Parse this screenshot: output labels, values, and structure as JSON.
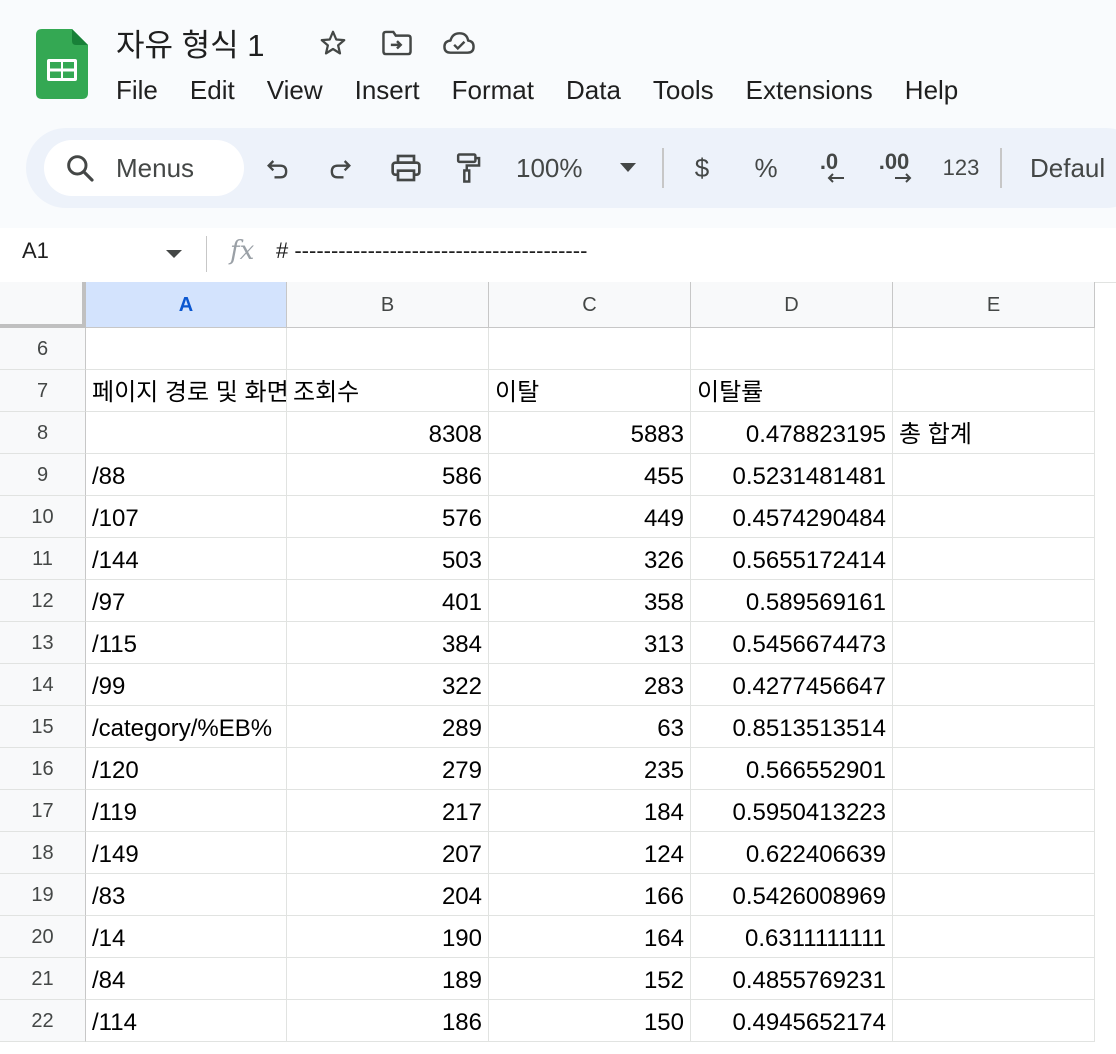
{
  "app": {
    "title": "자유 형식 1",
    "icons": {
      "logo": "google-sheets-logo",
      "star": "star-icon",
      "move": "move-to-folder-icon",
      "cloud": "cloud-saved-icon"
    }
  },
  "menu": [
    "File",
    "Edit",
    "View",
    "Insert",
    "Format",
    "Data",
    "Tools",
    "Extensions",
    "Help"
  ],
  "toolbar": {
    "search_label": "Menus",
    "zoom": "100%",
    "currency": "$",
    "percent": "%",
    "decrease_decimal": ".0",
    "increase_decimal": ".00",
    "number_format": "123",
    "font": "Defaul"
  },
  "formula_bar": {
    "name_box": "A1",
    "fx": "fx",
    "formula": "# ----------------------------------------"
  },
  "grid": {
    "selected_column": "A",
    "columns": [
      "A",
      "B",
      "C",
      "D",
      "E"
    ],
    "rows": [
      {
        "n": "6",
        "a": "",
        "b": "",
        "c": "",
        "d": "",
        "e": ""
      },
      {
        "n": "7",
        "a": "페이지 경로 및 화면",
        "b": "조회수",
        "c": "이탈",
        "d": "이탈률",
        "e": ""
      },
      {
        "n": "8",
        "a": "",
        "b": "8308",
        "c": "5883",
        "d": "0.478823195",
        "e": "총 합계"
      },
      {
        "n": "9",
        "a": "/88",
        "b": "586",
        "c": "455",
        "d": "0.5231481481",
        "e": ""
      },
      {
        "n": "10",
        "a": "/107",
        "b": "576",
        "c": "449",
        "d": "0.4574290484",
        "e": ""
      },
      {
        "n": "11",
        "a": "/144",
        "b": "503",
        "c": "326",
        "d": "0.5655172414",
        "e": ""
      },
      {
        "n": "12",
        "a": "/97",
        "b": "401",
        "c": "358",
        "d": "0.589569161",
        "e": ""
      },
      {
        "n": "13",
        "a": "/115",
        "b": "384",
        "c": "313",
        "d": "0.5456674473",
        "e": ""
      },
      {
        "n": "14",
        "a": "/99",
        "b": "322",
        "c": "283",
        "d": "0.4277456647",
        "e": ""
      },
      {
        "n": "15",
        "a": "/category/%EB%",
        "b": "289",
        "c": "63",
        "d": "0.8513513514",
        "e": ""
      },
      {
        "n": "16",
        "a": "/120",
        "b": "279",
        "c": "235",
        "d": "0.566552901",
        "e": ""
      },
      {
        "n": "17",
        "a": "/119",
        "b": "217",
        "c": "184",
        "d": "0.5950413223",
        "e": ""
      },
      {
        "n": "18",
        "a": "/149",
        "b": "207",
        "c": "124",
        "d": "0.622406639",
        "e": ""
      },
      {
        "n": "19",
        "a": "/83",
        "b": "204",
        "c": "166",
        "d": "0.5426008969",
        "e": ""
      },
      {
        "n": "20",
        "a": "/14",
        "b": "190",
        "c": "164",
        "d": "0.6311111111",
        "e": ""
      },
      {
        "n": "21",
        "a": "/84",
        "b": "189",
        "c": "152",
        "d": "0.4855769231",
        "e": ""
      },
      {
        "n": "22",
        "a": "/114",
        "b": "186",
        "c": "150",
        "d": "0.4945652174",
        "e": ""
      }
    ]
  }
}
